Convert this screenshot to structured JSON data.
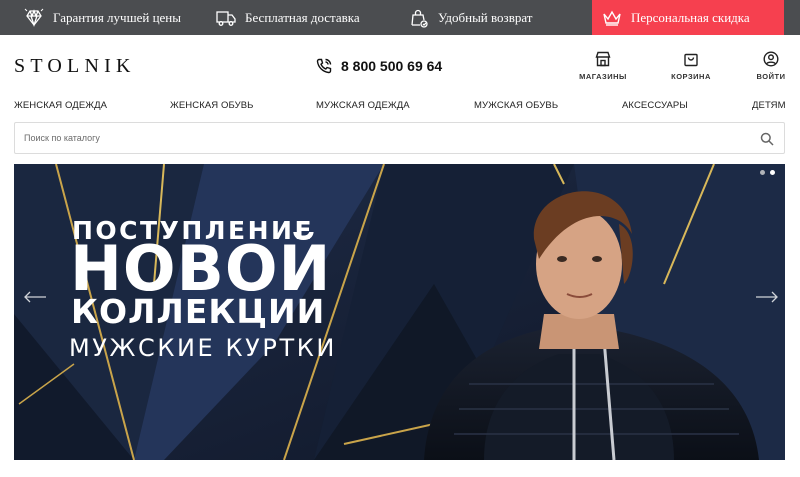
{
  "topbar": {
    "items": [
      {
        "label": "Гарантия лучшей цены",
        "icon": "diamond-icon"
      },
      {
        "label": "Бесплатная доставка",
        "icon": "truck-icon"
      },
      {
        "label": "Удобный возврат",
        "icon": "return-bag-icon"
      },
      {
        "label": "Персональная скидка",
        "icon": "crown-icon"
      }
    ],
    "accent": "#f6404f",
    "background": "#4b4d50"
  },
  "header": {
    "logo": "STOLNIK",
    "phone": "8 800 500 69 64",
    "icons": [
      {
        "label": "МАГАЗИНЫ",
        "icon": "store-icon"
      },
      {
        "label": "КОРЗИНА",
        "icon": "cart-icon"
      },
      {
        "label": "ВОЙТИ",
        "icon": "user-icon"
      }
    ]
  },
  "nav": {
    "items": [
      "ЖЕНСКАЯ ОДЕЖДА",
      "ЖЕНСКАЯ ОБУВЬ",
      "МУЖСКАЯ ОДЕЖДА",
      "МУЖСКАЯ ОБУВЬ",
      "АКСЕССУАРЫ",
      "ДЕТЯМ"
    ]
  },
  "search": {
    "placeholder": "Поиск по каталогу",
    "value": ""
  },
  "banner": {
    "line1": "ПОСТУПЛЕНИЕ",
    "line2": "НОВОЙ",
    "line3": "КОЛЛЕКЦИИ",
    "line4": "МУЖСКИЕ КУРТКИ",
    "slides": 2,
    "active_slide": 2
  }
}
